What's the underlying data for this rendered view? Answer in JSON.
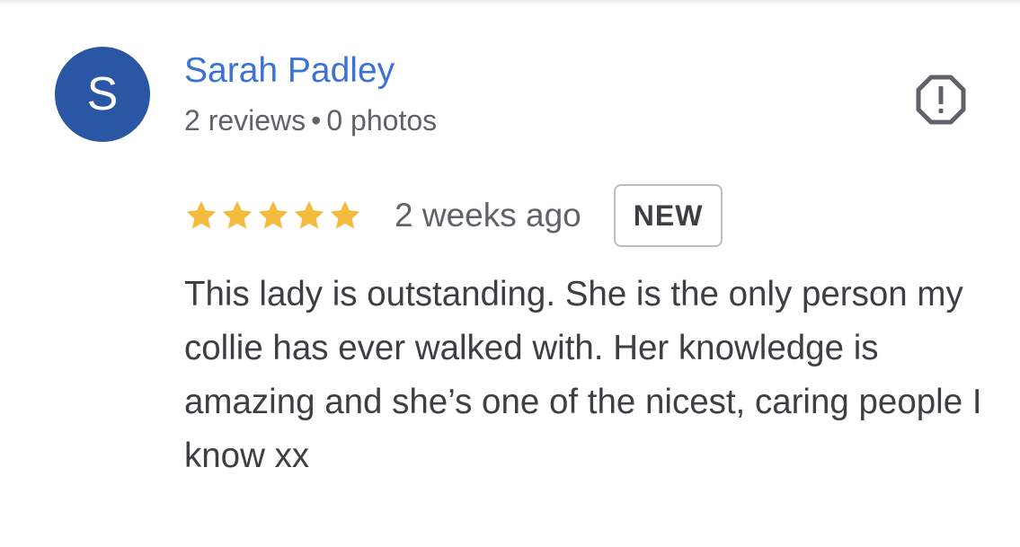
{
  "colors": {
    "avatar_bg": "#2957A4",
    "name": "#3B73D5",
    "meta": "#5f6368",
    "star": "#F4BB3E",
    "text": "#3c4043",
    "badge_text": "#3c4043",
    "icon": "#5f6368"
  },
  "reviewer": {
    "initial": "S",
    "name": "Sarah Padley",
    "reviews": "2 reviews",
    "separator": "•",
    "photos": "0 photos"
  },
  "report": {
    "icon": "report-flag-octagon-exclamation-icon"
  },
  "review": {
    "rating": 5,
    "max_rating": 5,
    "time": "2 weeks ago",
    "badge": "NEW",
    "text": "This lady is outstanding. She is the only person my collie has ever walked with. Her knowledge is amazing and she’s one of the nicest, caring people I know xx"
  }
}
